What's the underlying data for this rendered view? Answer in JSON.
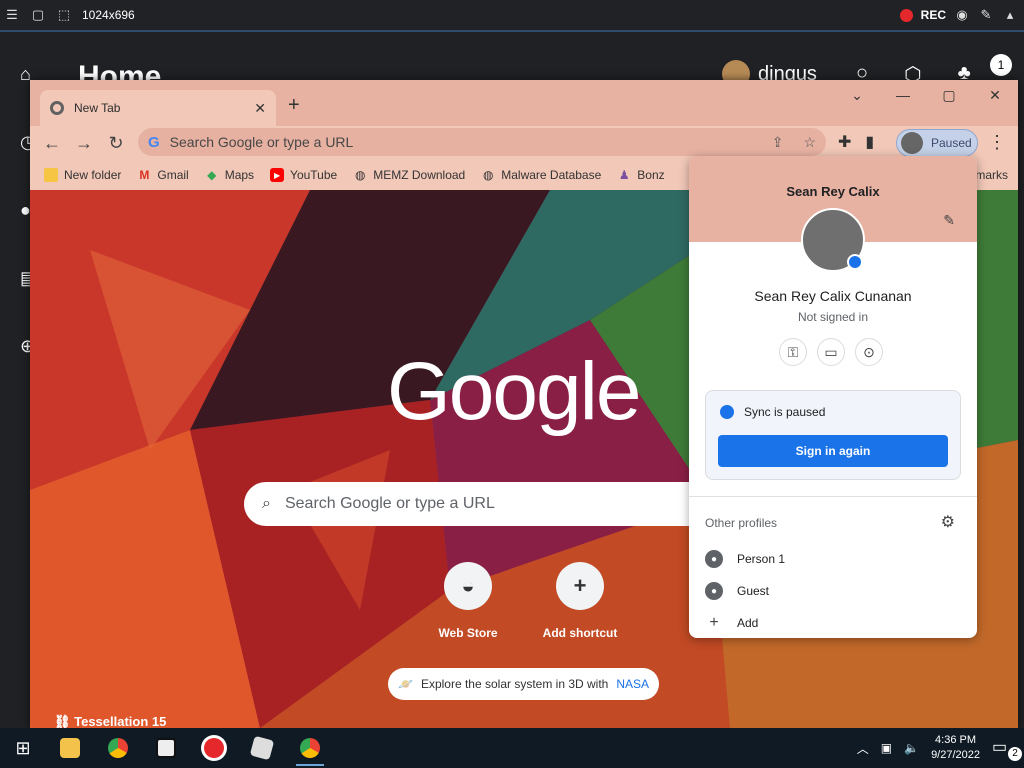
{
  "recorder": {
    "size_label": "1024x696",
    "rec_label": "REC"
  },
  "background_app": {
    "title": "Home",
    "username": "dingus",
    "badge_count": "1",
    "footer_text": "Tessellation 15"
  },
  "chrome": {
    "tab_title": "New Tab",
    "omnibox_placeholder": "Search Google or type a URL",
    "profile_chip": "Paused",
    "bookmarks": [
      {
        "label": "New folder",
        "icon": "folder-icon"
      },
      {
        "label": "Gmail",
        "icon": "gmail-icon"
      },
      {
        "label": "Maps",
        "icon": "maps-icon"
      },
      {
        "label": "YouTube",
        "icon": "youtube-icon"
      },
      {
        "label": "MEMZ Download",
        "icon": "globe-icon"
      },
      {
        "label": "Malware Database",
        "icon": "globe-icon"
      },
      {
        "label": "Bonz",
        "icon": "bonzi-icon"
      }
    ],
    "bookmarks_end": "marks"
  },
  "ntp": {
    "logo_text": "Google",
    "search_placeholder": "Search Google or type a URL",
    "shortcuts": [
      {
        "label": "Web Store"
      },
      {
        "label": "Add shortcut"
      }
    ],
    "promo_text": "Explore the solar system in 3D with",
    "promo_link": "NASA",
    "background_credit": "Tessellation 15"
  },
  "profile_menu": {
    "name": "Sean Rey Calix",
    "full_name": "Sean Rey Calix Cunanan",
    "status": "Not signed in",
    "sync_text": "Sync is paused",
    "sign_in_button": "Sign in again",
    "other_profiles_title": "Other profiles",
    "profiles": [
      {
        "label": "Person 1"
      },
      {
        "label": "Guest"
      },
      {
        "label": "Add"
      }
    ]
  },
  "taskbar": {
    "time": "4:36 PM",
    "date": "9/27/2022",
    "notification_count": "2"
  },
  "colors": {
    "accent_blue": "#1a73e8",
    "chrome_theme": "#e7b2a2",
    "recorder_red": "#e5282b"
  }
}
